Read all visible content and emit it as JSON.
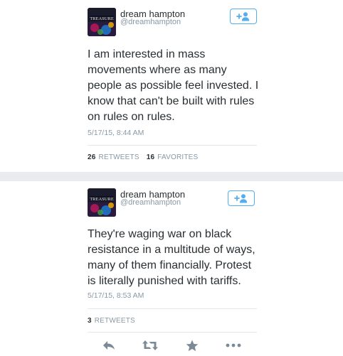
{
  "tweets": [
    {
      "display_name": "dream hampton",
      "handle": "@dreamhampton",
      "text": "I am interested in mass movements where as many people as possible feel invested. I know that can't be built with rules on rules on rules.",
      "timestamp": "5/17/15, 8:44 AM",
      "retweets_count": "26",
      "retweets_label": "RETWEETS",
      "favorites_count": "16",
      "favorites_label": "FAVORITES",
      "avatar_text": "TREASURE"
    },
    {
      "display_name": "dream hampton",
      "handle": "@dreamhampton",
      "text": "They're waging war on black resistance in a multitude of ways, many of them financially. Protest is literally punished with tariffs.",
      "timestamp": "5/17/15, 8:53 AM",
      "retweets_count": "3",
      "retweets_label": "RETWEETS",
      "avatar_text": "TREASURE"
    }
  ],
  "follow_button_icon": "add-user-icon",
  "actions": [
    {
      "name": "reply-icon"
    },
    {
      "name": "retweet-icon"
    },
    {
      "name": "favorite-icon"
    },
    {
      "name": "more-icon"
    }
  ],
  "colors": {
    "twitter_blue": "#55acee",
    "text": "#292f33",
    "muted": "#8899a6",
    "action_gray": "#7c8a96"
  }
}
